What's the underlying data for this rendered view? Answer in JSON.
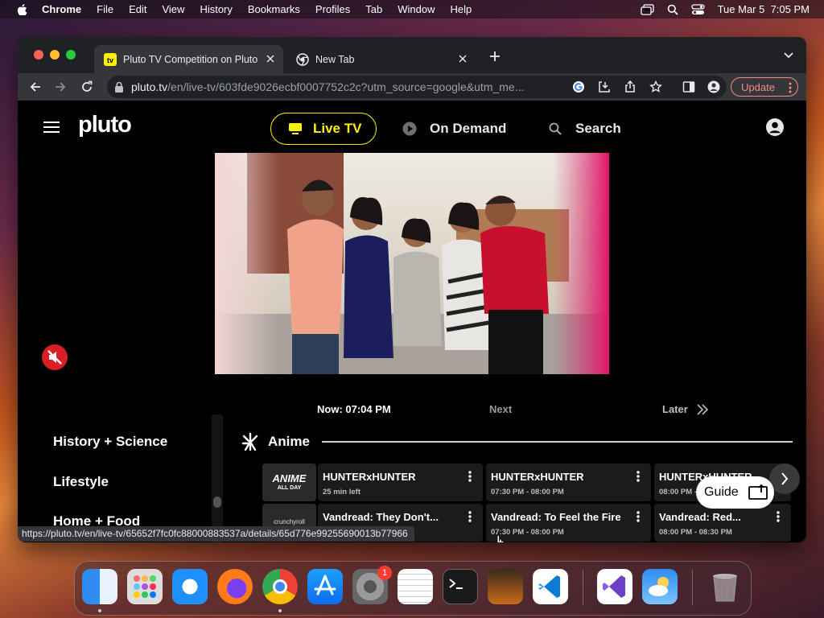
{
  "menubar": {
    "app": "Chrome",
    "items": [
      "File",
      "Edit",
      "View",
      "History",
      "Bookmarks",
      "Profiles",
      "Tab",
      "Window",
      "Help"
    ],
    "clock": "Tue Mar 5  7:05 PM"
  },
  "browser": {
    "tabs": [
      {
        "title": "Pluto TV Competition on Pluto",
        "favicon": "pluto-tv-favicon"
      },
      {
        "title": "New Tab",
        "favicon": "chrome-favicon"
      }
    ],
    "url_host": "pluto.tv",
    "url_path": "/en/live-tv/603fde9026ecbf0007752c2c?utm_source=google&utm_me...",
    "update_label": "Update",
    "status_url": "https://pluto.tv/en/live-tv/65652f7fc0fc88000883537a/details/65d776e99255690013b77966"
  },
  "pluto": {
    "logo": "pluto",
    "nav": {
      "live_tv": "Live TV",
      "on_demand": "On Demand",
      "search": "Search"
    },
    "timebar": {
      "now": "Now: 07:04 PM",
      "next": "Next",
      "later": "Later"
    },
    "categories": [
      "History + Science",
      "Lifestyle",
      "Home + Food"
    ],
    "row_title": "Anime",
    "channels": [
      {
        "logo_line1": "ANIME",
        "logo_line2": "ALL DAY",
        "programs": [
          {
            "title": "HUNTERxHUNTER",
            "subtitle": "25 min left"
          },
          {
            "title": "HUNTERxHUNTER",
            "subtitle": "07:30 PM - 08:00 PM"
          },
          {
            "title": "HUNTERxHUNTER",
            "subtitle": "08:00 PM - 08:30 PM"
          }
        ]
      },
      {
        "logo_line1": "crunchyroll",
        "programs": [
          {
            "title": "Vandread: They Don't...",
            "subtitle": ""
          },
          {
            "title": "Vandread: To Feel the Fire",
            "subtitle": "07:30 PM - 08:00 PM"
          },
          {
            "title": "Vandread: Red...",
            "subtitle": "08:00 PM - 08:30 PM"
          }
        ]
      }
    ],
    "guide_label": "Guide"
  },
  "dock": {
    "apps": [
      "finder-icon",
      "launchpad-icon",
      "safari-icon",
      "firefox-icon",
      "chrome-icon",
      "app-store-icon",
      "system-settings-icon",
      "textedit-icon",
      "terminal-icon",
      "garageband-icon",
      "vscode-icon",
      "visual-studio-icon",
      "weather-icon",
      "trash-icon"
    ],
    "badge": "1"
  },
  "colors": {
    "accent": "#fff200",
    "mute": "#d81f26",
    "update": "#f28b82"
  }
}
